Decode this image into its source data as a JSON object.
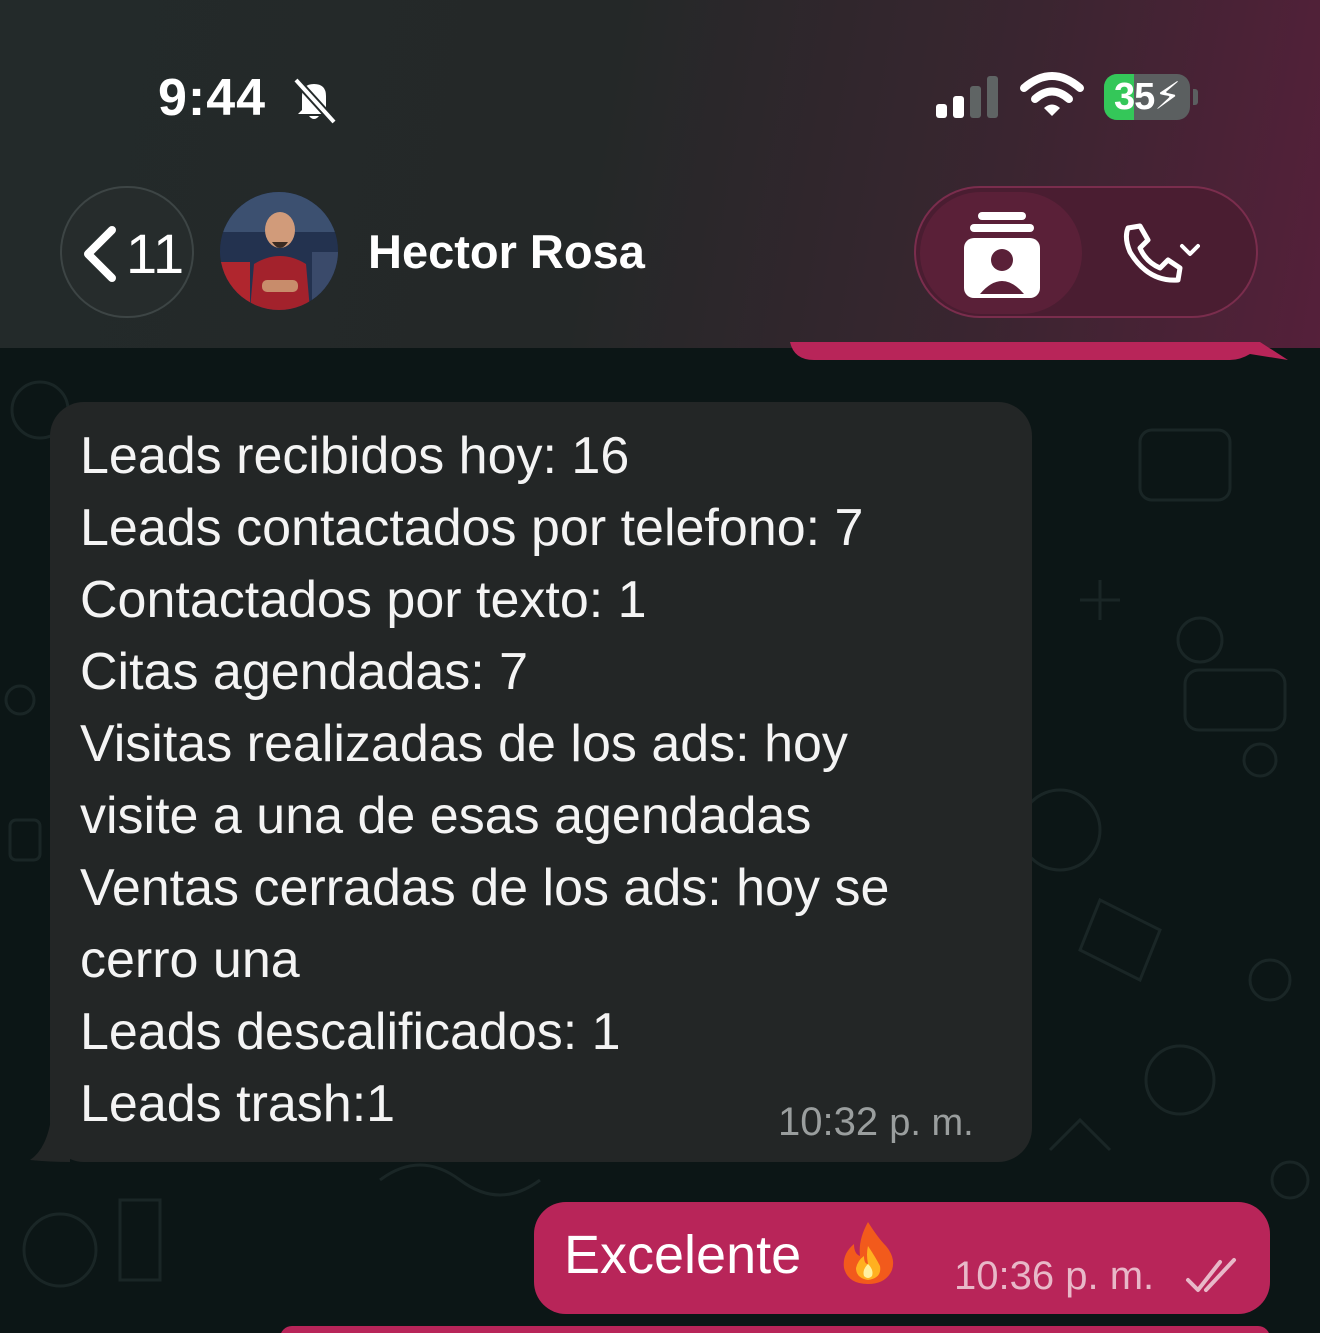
{
  "status_bar": {
    "time": "9:44",
    "battery_percent": "35",
    "battery_level": 0.35,
    "icons": [
      "bell-slash-icon",
      "cellular-signal-icon",
      "wifi-icon",
      "battery-charging-icon"
    ]
  },
  "header": {
    "back_count": "11",
    "contact_name": "Hector Rosa",
    "icons": [
      "chevron-left-icon",
      "contact-card-icon",
      "phone-icon",
      "chevron-down-icon"
    ]
  },
  "messages": [
    {
      "direction": "incoming",
      "lines": [
        "Leads recibidos hoy: 16",
        "Leads contactados por telefono: 7",
        "Contactados por texto: 1",
        "Citas agendadas: 7",
        "Visitas realizadas de los ads: hoy",
        "visite a una de esas agendadas",
        "Ventas cerradas de los ads: hoy se",
        "cerro una",
        "Leads descalificados: 1",
        "Leads trash:1"
      ],
      "time": "10:32",
      "time_suffix": "p. m."
    },
    {
      "direction": "outgoing",
      "text": "Excelente",
      "emoji": "fire-icon",
      "time": "10:36",
      "time_suffix": "p. m.",
      "status": "read-double-check-icon"
    }
  ],
  "colors": {
    "outgoing_bubble": "#b82559",
    "incoming_bubble": "#232626",
    "chat_background": "#0c1616",
    "battery_green": "#34c759"
  }
}
